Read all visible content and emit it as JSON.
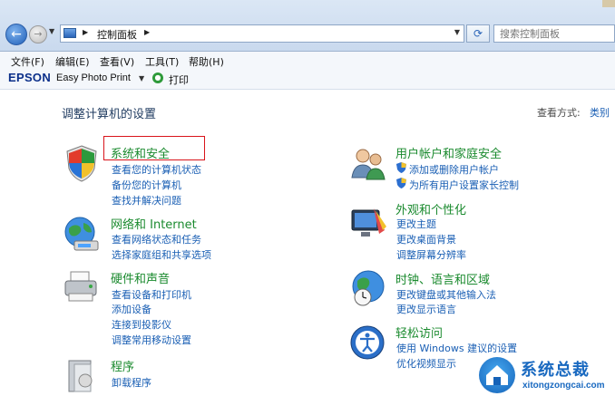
{
  "address": {
    "crumb": "控制面板",
    "search_placeholder": "搜索控制面板"
  },
  "menu": [
    "文件(F)",
    "编辑(E)",
    "查看(V)",
    "工具(T)",
    "帮助(H)"
  ],
  "epson": {
    "brand": "EPSON",
    "app": "Easy Photo Print",
    "print": "打印"
  },
  "page": {
    "title": "调整计算机的设置",
    "viewby_label": "查看方式:",
    "viewby_value": "类别"
  },
  "categories": {
    "system": {
      "title": "系统和安全",
      "links": [
        "查看您的计算机状态",
        "备份您的计算机",
        "查找并解决问题"
      ]
    },
    "network": {
      "title": "网络和 Internet",
      "links": [
        "查看网络状态和任务",
        "选择家庭组和共享选项"
      ]
    },
    "hardware": {
      "title": "硬件和声音",
      "links": [
        "查看设备和打印机",
        "添加设备",
        "连接到投影仪",
        "调整常用移动设置"
      ]
    },
    "programs": {
      "title": "程序",
      "links": [
        "卸载程序"
      ]
    },
    "users": {
      "title": "用户帐户和家庭安全",
      "links": [
        "添加或删除用户帐户",
        "为所有用户设置家长控制"
      ]
    },
    "appearance": {
      "title": "外观和个性化",
      "links": [
        "更改主题",
        "更改桌面背景",
        "调整屏幕分辨率"
      ]
    },
    "clock": {
      "title": "时钟、语言和区域",
      "links": [
        "更改键盘或其他输入法",
        "更改显示语言"
      ]
    },
    "ease": {
      "title": "轻松访问",
      "links": [
        "使用 Windows 建议的设置",
        "优化视频显示"
      ]
    }
  },
  "watermark": {
    "title": "系统总裁",
    "url": "xitongzongcai.com"
  }
}
